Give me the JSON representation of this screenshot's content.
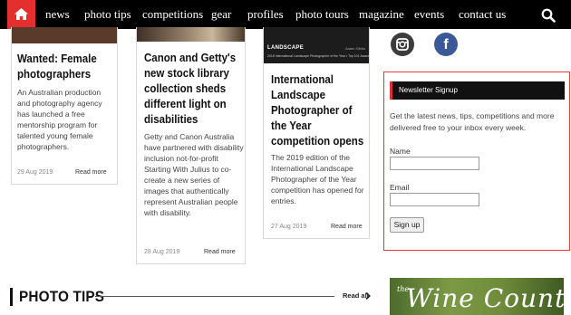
{
  "nav": {
    "items": [
      "news",
      "photo tips",
      "competitions",
      "gear",
      "profiles",
      "photo tours",
      "magazine",
      "events",
      "contact us"
    ]
  },
  "articles": [
    {
      "title": "Wanted: Female photographers",
      "excerpt": "An Australian production and photography agency has launched a free mentorship program for talented young female photographers.",
      "date": "29 Aug 2019",
      "more": "Read more"
    },
    {
      "title": "Canon and Getty's new stock library collection sheds different light on disabilities",
      "excerpt": "Getty and Canon Australia have partnered with disability inclusion not-for-profit Starting With Julius to co-create a new series of images that authentically represent Australian people with disability.",
      "date": "28 Aug 2019",
      "more": "Read more"
    },
    {
      "title": "International Landscape Photographer of the Year competition opens",
      "excerpt": "The 2019 edition of the International Landscape Photographer of the Year competition has opened for entries.",
      "date": "27 Aug 2019",
      "more": "Read more",
      "thumb_brand": "LANDSCAPE",
      "thumb_sub": "2018 International Landscape Photographer of the Year • Top 101 Award",
      "thumb_by": "Adam Gibbs"
    }
  ],
  "newsletter": {
    "heading": "Newsletter Signup",
    "description": "Get the latest news, tips, competitions and more delivered free to your inbox every week.",
    "name_label": "Name",
    "name_value": "",
    "email_label": "Email",
    "email_value": "",
    "button": "Sign up"
  },
  "photo_tips": {
    "heading": "PHOTO TIPS",
    "read_all": "Read all"
  },
  "ad": {
    "the": "the",
    "text": "Wine Country"
  },
  "colors": {
    "accent": "#e3302f",
    "nav_bg": "#000000",
    "facebook": "#3b5998",
    "instagram": "#3c3c3c"
  },
  "icons": [
    "home-icon",
    "search-icon",
    "instagram-icon",
    "facebook-icon",
    "chevron-right-icon"
  ]
}
